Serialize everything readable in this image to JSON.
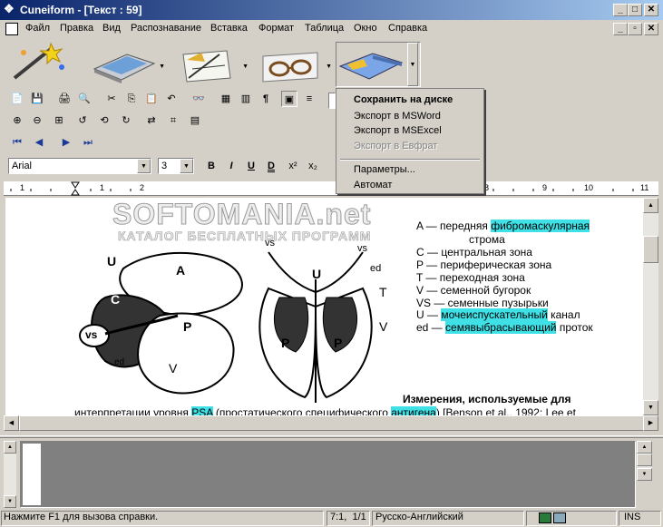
{
  "window": {
    "title": "Cuneiform - [Текст : 59]"
  },
  "menubar": {
    "items": [
      "Файл",
      "Правка",
      "Вид",
      "Распознавание",
      "Вставка",
      "Формат",
      "Таблица",
      "Окно",
      "Справка"
    ]
  },
  "toolbar": {
    "big_buttons": [
      "magic-wand-icon",
      "scanner-icon",
      "drawing-tools-icon",
      "glasses-icon",
      "save-disk-icon"
    ],
    "font": "Arial",
    "size": "3",
    "format_buttons": [
      "B",
      "I",
      "U",
      "D",
      "x²",
      "x₂"
    ]
  },
  "dropdown_menu": {
    "items": [
      {
        "label": "Сохранить на диске",
        "bold": true,
        "enabled": true
      },
      {
        "label": "Экспорт в MSWord",
        "enabled": true
      },
      {
        "label": "Экспорт в MSExcel",
        "enabled": true
      },
      {
        "label": "Экспорт в Евфрат",
        "enabled": false
      },
      {
        "label": "Параметры...",
        "enabled": true
      },
      {
        "label": "Автомат",
        "enabled": true
      }
    ]
  },
  "ruler": {
    "left_ticks": [
      "1",
      "1",
      "2"
    ],
    "right_ticks": [
      "8",
      "9",
      "10",
      "11"
    ]
  },
  "watermark": {
    "title": "SOFTOMANIA.net",
    "subtitle": "КАТАЛОГ БЕСПЛАТНЫХ ПРОГРАММ"
  },
  "document": {
    "figure_labels": [
      "U",
      "A",
      "C",
      "vs",
      "P",
      "ed",
      "V",
      "vs",
      "vs",
      "U",
      "C",
      "C",
      "ed",
      "T",
      "P",
      "P",
      "V"
    ],
    "legend": [
      {
        "pre": "A — передняя ",
        "hl": "фибромаскулярная",
        "post": ""
      },
      {
        "pre": "строма",
        "hl": "",
        "post": ""
      },
      {
        "pre": "C — центральная зона",
        "hl": "",
        "post": ""
      },
      {
        "pre": "P — периферическая зона",
        "hl": "",
        "post": ""
      },
      {
        "pre": "T — переходная зона",
        "hl": "",
        "post": ""
      },
      {
        "pre": "V — семенной бугорок",
        "hl": "",
        "post": ""
      },
      {
        "pre": "VS — семенные пузырьки",
        "hl": "",
        "post": ""
      },
      {
        "pre": "U — ",
        "hl": "мочеиспускательный",
        "post": " канал"
      },
      {
        "pre": "ed — ",
        "hl": "семявыбрасывающий",
        "post": " проток"
      }
    ],
    "heading": "Измерения, используемые для",
    "body_pre": "интерпретации уровня ",
    "body_hl1": "PSA",
    "body_mid": " (простатического специфического ",
    "body_hl2": "антигена",
    "body_post": ") [Benson et al., 1992; Lee et"
  },
  "statusbar": {
    "help": "Нажмите F1 для вызова справки.",
    "position": "7:1,  1/1",
    "language": "Русско-Английский",
    "mode": "INS"
  },
  "colors": {
    "highlight": "#3fe0e6",
    "titlebar": "#0a246a",
    "face": "#d4d0c8"
  }
}
